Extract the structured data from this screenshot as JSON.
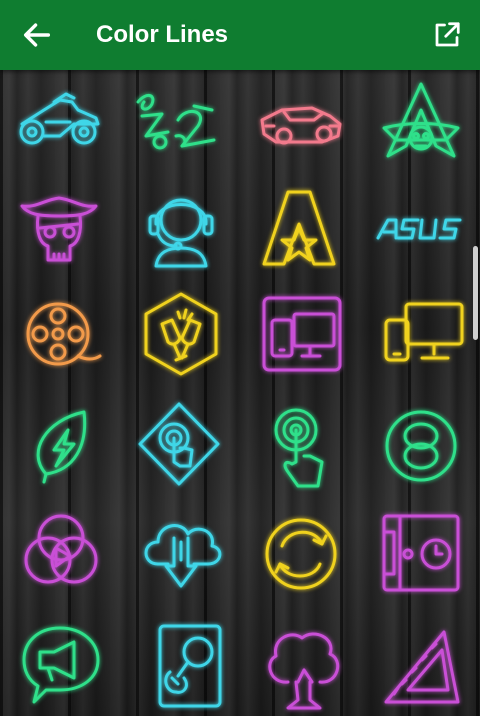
{
  "appbar": {
    "title": "Color Lines",
    "back_icon": "arrow-left-icon",
    "open_icon": "open-in-new-icon",
    "color": "#0f7d30"
  },
  "icon_colors": {
    "cyan": "#3fd6e8",
    "green": "#2fe08a",
    "pink": "#f27a8c",
    "magenta": "#c94fd6",
    "yellow": "#f0d21e",
    "orange": "#f29a4a"
  },
  "icons": [
    {
      "name": "motorcycle-icon",
      "color": "cyan"
    },
    {
      "name": "z2-logo-icon",
      "color": "green"
    },
    {
      "name": "sports-car-icon",
      "color": "pink"
    },
    {
      "name": "assassins-creed-icon",
      "color": "green"
    },
    {
      "name": "pirate-skull-icon",
      "color": "magenta"
    },
    {
      "name": "headset-support-icon",
      "color": "cyan"
    },
    {
      "name": "star-a-logo-icon",
      "color": "yellow"
    },
    {
      "name": "asus-logo-icon",
      "color": "cyan"
    },
    {
      "name": "film-reel-icon",
      "color": "orange"
    },
    {
      "name": "cheers-glasses-icon",
      "color": "yellow"
    },
    {
      "name": "devices-magenta-icon",
      "color": "magenta"
    },
    {
      "name": "devices-yellow-icon",
      "color": "yellow"
    },
    {
      "name": "leaf-bolt-icon",
      "color": "green"
    },
    {
      "name": "tap-diamond-icon",
      "color": "cyan"
    },
    {
      "name": "touch-hand-icon",
      "color": "green"
    },
    {
      "name": "rings-circle-icon",
      "color": "green"
    },
    {
      "name": "overlap-circles-icon",
      "color": "magenta"
    },
    {
      "name": "cloud-download-icon",
      "color": "cyan"
    },
    {
      "name": "sync-circle-icon",
      "color": "yellow"
    },
    {
      "name": "safe-clock-icon",
      "color": "magenta"
    },
    {
      "name": "megaphone-chat-icon",
      "color": "green"
    },
    {
      "name": "search-guitar-icon",
      "color": "cyan"
    },
    {
      "name": "tree-icon",
      "color": "magenta"
    },
    {
      "name": "ruler-triangle-icon",
      "color": "magenta"
    }
  ]
}
